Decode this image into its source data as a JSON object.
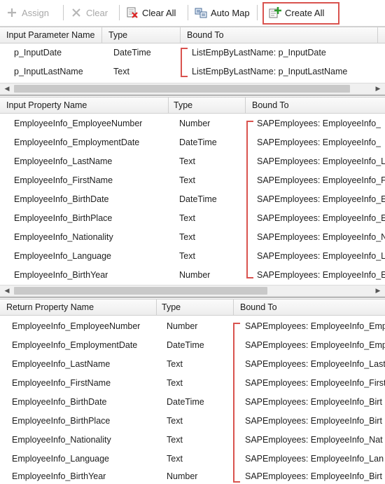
{
  "toolbar": {
    "assign": "Assign",
    "clear": "Clear",
    "clear_all": "Clear All",
    "auto_map": "Auto Map",
    "create_all": "Create All"
  },
  "input_params": {
    "headers": [
      "Input Parameter Name",
      "Type",
      "Bound To"
    ],
    "rows": [
      {
        "name": "p_InputDate",
        "type": "DateTime",
        "bound": "ListEmpByLastName: p_InputDate"
      },
      {
        "name": "p_InputLastName",
        "type": "Text",
        "bound": "ListEmpByLastName: p_InputLastName"
      }
    ]
  },
  "input_props": {
    "headers": [
      "Input Property Name",
      "Type",
      "Bound To"
    ],
    "rows": [
      {
        "name": "EmployeeInfo_EmployeeNumber",
        "type": "Number",
        "bound": "SAPEmployees: EmployeeInfo_"
      },
      {
        "name": "EmployeeInfo_EmploymentDate",
        "type": "DateTime",
        "bound": "SAPEmployees: EmployeeInfo_"
      },
      {
        "name": "EmployeeInfo_LastName",
        "type": "Text",
        "bound": "SAPEmployees: EmployeeInfo_L"
      },
      {
        "name": "EmployeeInfo_FirstName",
        "type": "Text",
        "bound": "SAPEmployees: EmployeeInfo_F"
      },
      {
        "name": "EmployeeInfo_BirthDate",
        "type": "DateTime",
        "bound": "SAPEmployees: EmployeeInfo_E"
      },
      {
        "name": "EmployeeInfo_BirthPlace",
        "type": "Text",
        "bound": "SAPEmployees: EmployeeInfo_E"
      },
      {
        "name": "EmployeeInfo_Nationality",
        "type": "Text",
        "bound": "SAPEmployees: EmployeeInfo_N"
      },
      {
        "name": "EmployeeInfo_Language",
        "type": "Text",
        "bound": "SAPEmployees: EmployeeInfo_L"
      },
      {
        "name": "EmployeeInfo_BirthYear",
        "type": "Number",
        "bound": "SAPEmployees: EmployeeInfo_E"
      }
    ]
  },
  "return_props": {
    "headers": [
      "Return Property Name",
      "Type",
      "Bound To"
    ],
    "rows": [
      {
        "name": "EmployeeInfo_EmployeeNumber",
        "type": "Number",
        "bound": "SAPEmployees: EmployeeInfo_Emp"
      },
      {
        "name": "EmployeeInfo_EmploymentDate",
        "type": "DateTime",
        "bound": "SAPEmployees: EmployeeInfo_Emp"
      },
      {
        "name": "EmployeeInfo_LastName",
        "type": "Text",
        "bound": "SAPEmployees: EmployeeInfo_Last"
      },
      {
        "name": "EmployeeInfo_FirstName",
        "type": "Text",
        "bound": "SAPEmployees: EmployeeInfo_First"
      },
      {
        "name": "EmployeeInfo_BirthDate",
        "type": "DateTime",
        "bound": "SAPEmployees: EmployeeInfo_Birt"
      },
      {
        "name": "EmployeeInfo_BirthPlace",
        "type": "Text",
        "bound": "SAPEmployees: EmployeeInfo_Birt"
      },
      {
        "name": "EmployeeInfo_Nationality",
        "type": "Text",
        "bound": "SAPEmployees: EmployeeInfo_Nat"
      },
      {
        "name": "EmployeeInfo_Language",
        "type": "Text",
        "bound": "SAPEmployees: EmployeeInfo_Lan"
      },
      {
        "name": "EmployeeInfo_BirthYear",
        "type": "Number",
        "bound": "SAPEmployees: EmployeeInfo_Birt"
      }
    ]
  },
  "colors": {
    "highlight": "#d9534f",
    "header_bg": "#ededed",
    "border": "#cfcfcf"
  }
}
